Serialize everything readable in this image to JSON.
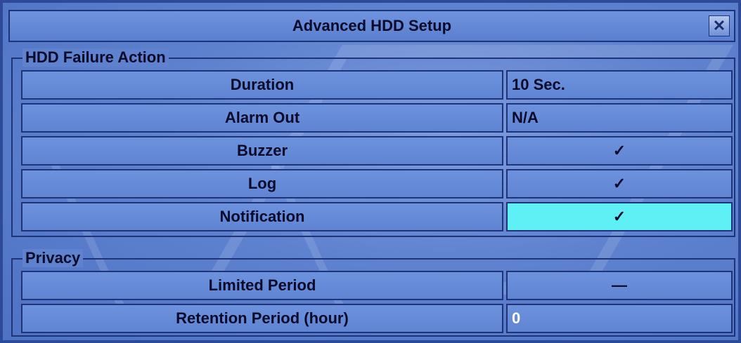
{
  "dialog": {
    "title": "Advanced HDD Setup",
    "close_glyph": "✕"
  },
  "hdd_failure": {
    "legend": "HDD Failure Action",
    "rows": [
      {
        "label": "Duration",
        "value": "10 Sec."
      },
      {
        "label": "Alarm Out",
        "value": "N/A"
      },
      {
        "label": "Buzzer",
        "value": "✓"
      },
      {
        "label": "Log",
        "value": "✓"
      },
      {
        "label": "Notification",
        "value": "✓"
      }
    ]
  },
  "privacy": {
    "legend": "Privacy",
    "rows": [
      {
        "label": "Limited Period",
        "value": "—"
      },
      {
        "label": "Retention Period (hour)",
        "value": "0"
      }
    ]
  },
  "colors": {
    "background": "#5f82cf",
    "border": "#1e3478",
    "selected": "#5ff0f6"
  },
  "icons": {
    "close": "close-icon",
    "check": "checkmark-icon"
  }
}
